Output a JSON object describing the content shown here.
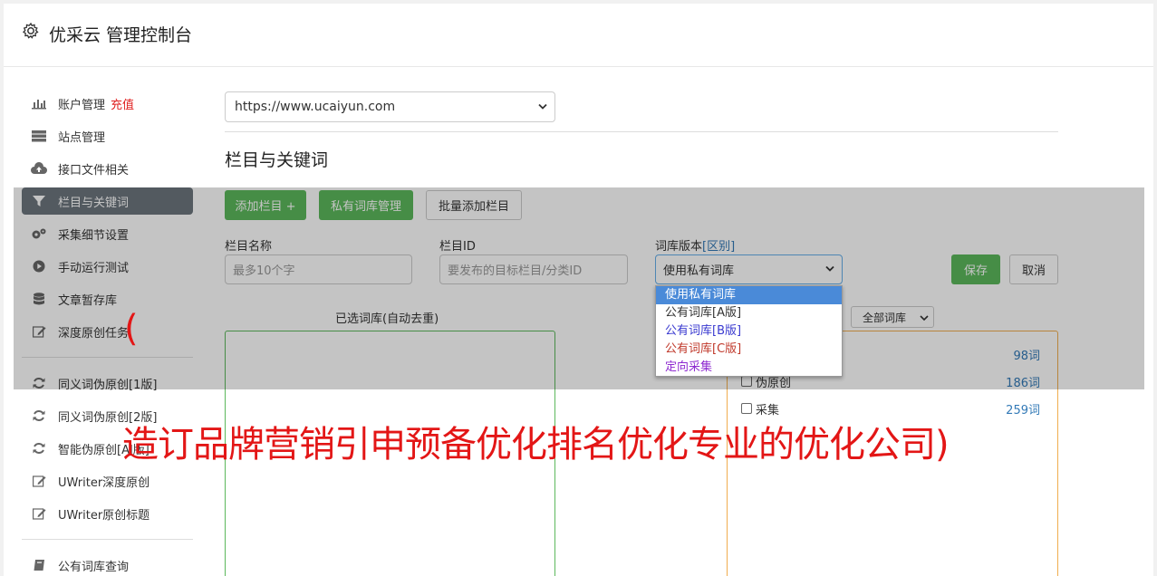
{
  "header": {
    "title": "优采云 管理控制台",
    "icon": "gear-icon"
  },
  "sidebar": {
    "items": [
      {
        "label": "账户管理",
        "extra": "充值",
        "icon": "bar-chart-icon"
      },
      {
        "label": "站点管理",
        "icon": "server-icon"
      },
      {
        "label": "接口文件相关",
        "icon": "cloud-upload-icon"
      },
      {
        "label": "栏目与关键词",
        "icon": "filter-icon",
        "active": true
      },
      {
        "label": "采集细节设置",
        "icon": "gears-icon"
      },
      {
        "label": "手动运行测试",
        "icon": "play-icon"
      },
      {
        "label": "文章暂存库",
        "icon": "database-icon"
      },
      {
        "label": "深度原创任务",
        "icon": "edit-icon"
      },
      {
        "label": "同义词伪原创[1版]",
        "icon": "refresh-icon"
      },
      {
        "label": "同义词伪原创[2版]",
        "icon": "refresh-icon"
      },
      {
        "label": "智能伪原创[AI版]",
        "icon": "refresh-icon"
      },
      {
        "label": "UWriter深度原创",
        "icon": "edit-icon"
      },
      {
        "label": "UWriter原创标题",
        "icon": "edit-icon"
      },
      {
        "label": "公有词库查询",
        "icon": "book-icon"
      }
    ]
  },
  "main": {
    "site_select": "https://www.ucaiyun.com",
    "section_title": "栏目与关键词",
    "buttons": {
      "add_column": "添加栏目 +",
      "private_lib": "私有词库管理",
      "batch_add": "批量添加栏目",
      "save": "保存",
      "cancel": "取消"
    },
    "form": {
      "name_label": "栏目名称",
      "name_placeholder": "最多10个字",
      "id_label": "栏目ID",
      "id_placeholder": "要发布的目标栏目/分类ID",
      "version_label": "词库版本",
      "version_hint": "[区别]",
      "version_value": "使用私有词库"
    },
    "dropdown_options": [
      {
        "label": "使用私有词库",
        "color": "#ffffff",
        "selected": true
      },
      {
        "label": "公有词库[A版]",
        "color": "#333333"
      },
      {
        "label": "公有词库[B版]",
        "color": "#3a3ad0"
      },
      {
        "label": "公有词库[C版]",
        "color": "#c0392b"
      },
      {
        "label": "定向采集",
        "color": "#8e2ad0"
      }
    ],
    "selected_lib_label": "已选词库(自动去重)",
    "all_lib_select": "全部词库",
    "lib_rows": [
      {
        "label": "",
        "count": "98词"
      },
      {
        "label": "伪原创",
        "count": "186词"
      },
      {
        "label": "采集",
        "count": "259词"
      }
    ]
  },
  "watermark": {
    "text": "造订品牌营销引申预备优化排名优化专业的优化公司)",
    "paren": "("
  }
}
